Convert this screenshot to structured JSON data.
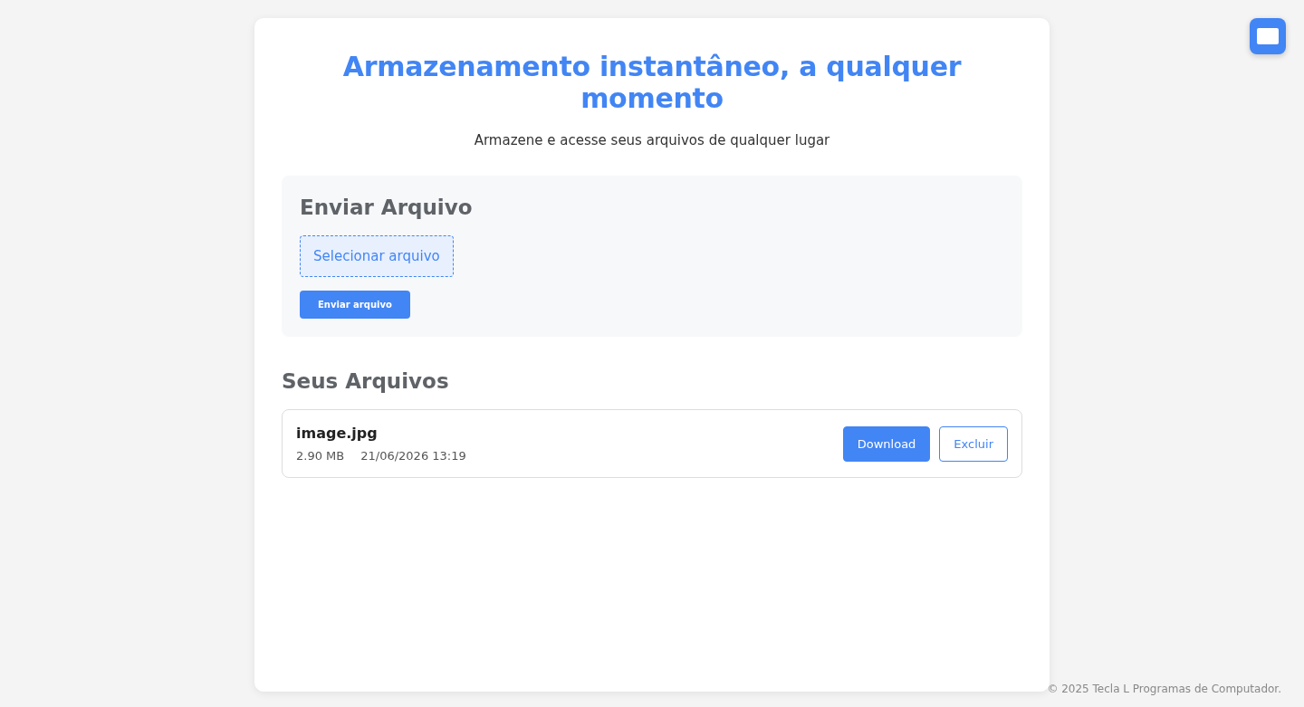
{
  "header": {
    "title": "Armazenamento instantâneo, a qualquer momento",
    "subtitle": "Armazene e acesse seus arquivos de qualquer lugar"
  },
  "upload": {
    "heading": "Enviar Arquivo",
    "select_label": "Selecionar arquivo",
    "submit_label": "Enviar arquivo"
  },
  "files": {
    "heading": "Seus Arquivos",
    "items": [
      {
        "name": "image.jpg",
        "size": "2.90 MB",
        "date": "21/06/2026 13:19",
        "actions": [
          "Download",
          "Excluir"
        ]
      }
    ]
  },
  "footer": "© 2025 Tecla L Programas de Computador."
}
